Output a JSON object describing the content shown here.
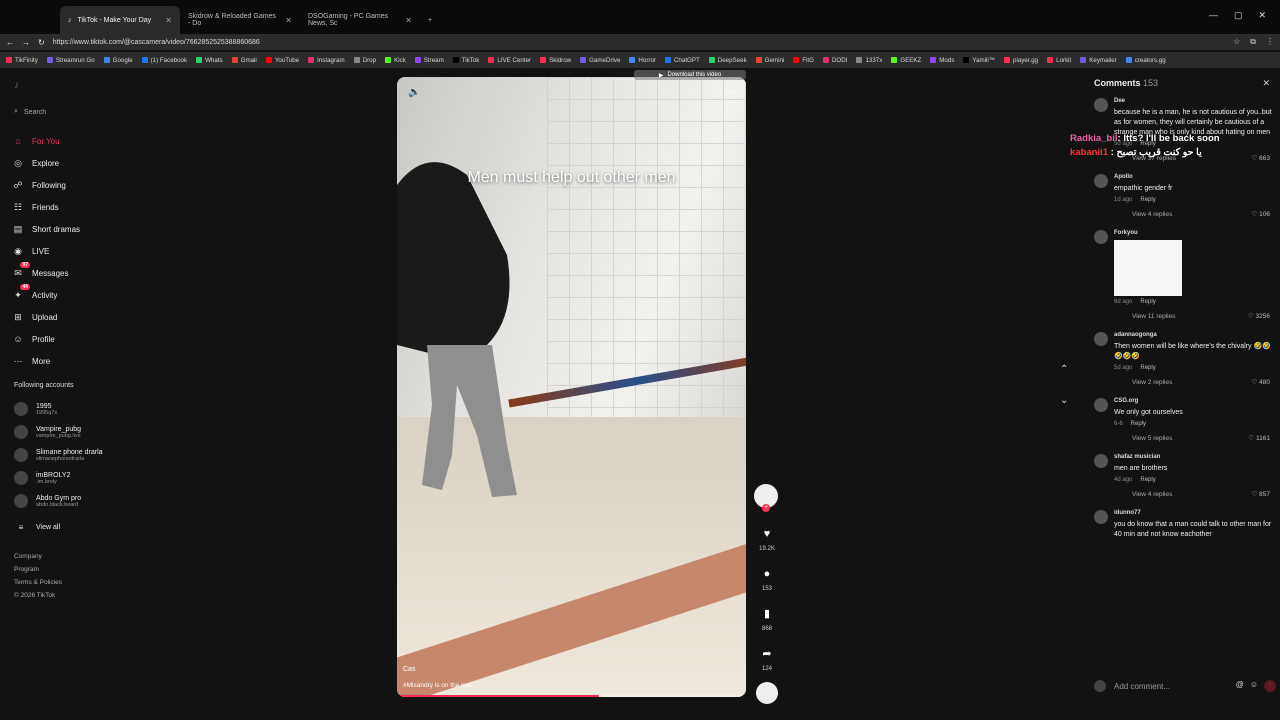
{
  "browser": {
    "tabs": [
      {
        "label": "TikTok - Make Your Day",
        "active": true
      },
      {
        "label": "Skidrow & Reloaded Games - Do",
        "active": false
      },
      {
        "label": "DSOGaming - PC Games News, Sc",
        "active": false
      }
    ],
    "url": "https://www.tiktok.com/@cascamera/video/7662852525388860686",
    "bookmarks": [
      "TikFinity",
      "Streamrun Go",
      "Google",
      "(1) Facebook",
      "Whats",
      "Gmail",
      "YouTube",
      "Instagram",
      "Drop",
      "Kick",
      "Stream",
      "TikTok",
      "LIVE Center",
      "Skidrow",
      "GameDrive",
      "Horror",
      "ChatGPT",
      "DeepSeek",
      "Gemini",
      "FitG",
      "DODI",
      "1337x",
      "GEEKZ",
      "Mods",
      "Yamili™",
      "player.gg",
      "Lorkit",
      "Keymailer",
      "creators.gg"
    ]
  },
  "sidebar": {
    "search_placeholder": "Search",
    "nav": [
      {
        "label": "For You",
        "icon": "home-icon",
        "active": true,
        "badge": ""
      },
      {
        "label": "Explore",
        "icon": "compass-icon",
        "active": false,
        "badge": ""
      },
      {
        "label": "Following",
        "icon": "following-icon",
        "active": false,
        "badge": ""
      },
      {
        "label": "Friends",
        "icon": "friends-icon",
        "active": false,
        "badge": ""
      },
      {
        "label": "Short dramas",
        "icon": "film-icon",
        "active": false,
        "badge": ""
      },
      {
        "label": "LIVE",
        "icon": "live-icon",
        "active": false,
        "badge": ""
      },
      {
        "label": "Messages",
        "icon": "messages-icon",
        "active": false,
        "badge": "97"
      },
      {
        "label": "Activity",
        "icon": "activity-icon",
        "active": false,
        "badge": "44"
      },
      {
        "label": "Upload",
        "icon": "upload-icon",
        "active": false,
        "badge": ""
      },
      {
        "label": "Profile",
        "icon": "profile-icon",
        "active": false,
        "badge": ""
      },
      {
        "label": "More",
        "icon": "more-icon",
        "active": false,
        "badge": ""
      }
    ],
    "following_title": "Following accounts",
    "accounts": [
      {
        "name": "1995",
        "handle": "1995q7x"
      },
      {
        "name": "Vampire_pubg",
        "handle": "vampire_pubg.live"
      },
      {
        "name": "Slimane phone drarla",
        "handle": "slimanephonedrarla"
      },
      {
        "name": "imBROLY2",
        "handle": ".im.broly"
      },
      {
        "name": "Abdo Gym pro",
        "handle": "abdo.black.beard"
      }
    ],
    "view_all": "View all",
    "footer": [
      "Company",
      "Program",
      "Terms & Policies",
      "© 2026 TikTok"
    ]
  },
  "video": {
    "overlay_text": "Men must help out other men",
    "download_label": "Download this video",
    "author": "Cas",
    "caption_tag": "#Misandry",
    "caption_rest": " is on the rise",
    "progress": 0.58
  },
  "actions": {
    "likes": "19.2K",
    "comments": "153",
    "saves": "868",
    "shares": "124"
  },
  "comments": {
    "title": "Comments",
    "count": "153",
    "items": [
      {
        "user": "Dee",
        "text": "because he is a man, he is not cautious of you..but as for women, they will certainly be cautious of a strange man who is only kind about hating on men",
        "time": "5d ago",
        "likes": "663",
        "replies": "View 37 replies"
      },
      {
        "user": "Apollo",
        "text": "empathic gender fr",
        "time": "1d ago",
        "likes": "106",
        "replies": "View 4 replies"
      },
      {
        "user": "Forkyou",
        "text": "",
        "time": "6d ago",
        "likes": "3256",
        "replies": "View 11 replies"
      },
      {
        "user": "adannaogonga",
        "text": "Then women will be like where's the chivalry 🤣🤣🤣🤣🤣",
        "time": "5d ago",
        "likes": "480",
        "replies": "View 2 replies"
      },
      {
        "user": "CSG.org",
        "text": "We only got ourselves",
        "time": "6-6",
        "likes": "1161",
        "replies": "View 5 replies"
      },
      {
        "user": "shafaz musician",
        "text": "men are brothers",
        "time": "4d ago",
        "likes": "857",
        "replies": "View 4 replies"
      },
      {
        "user": "idunno77",
        "text": "you do know that a man could talk to other man for 40 min and not know eachother",
        "time": "",
        "likes": "",
        "replies": ""
      }
    ],
    "reply_label": "Reply",
    "add_placeholder": "Add comment..."
  },
  "stream_overlay": {
    "line1_name": "Radkia_bil",
    "line1_text": ": Itts? I'll be back soon",
    "line2_name": "kabanii1",
    "line2_text": ": يا حو كنت قريب تصبح"
  }
}
